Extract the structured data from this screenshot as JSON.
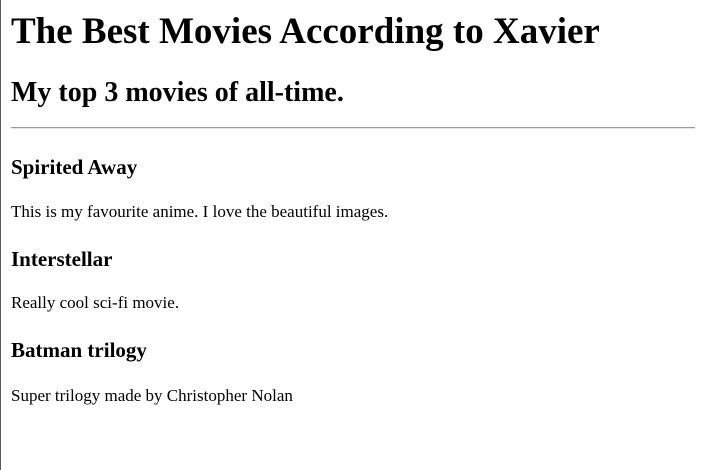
{
  "page": {
    "title": "The Best Movies According to Xavier",
    "subtitle": "My top 3 movies of all-time."
  },
  "movies": [
    {
      "title": "Spirited Away",
      "description": "This is my favourite anime. I love the beautiful images."
    },
    {
      "title": "Interstellar",
      "description": "Really cool sci-fi movie."
    },
    {
      "title": "Batman trilogy",
      "description": "Super trilogy made by Christopher Nolan"
    }
  ]
}
